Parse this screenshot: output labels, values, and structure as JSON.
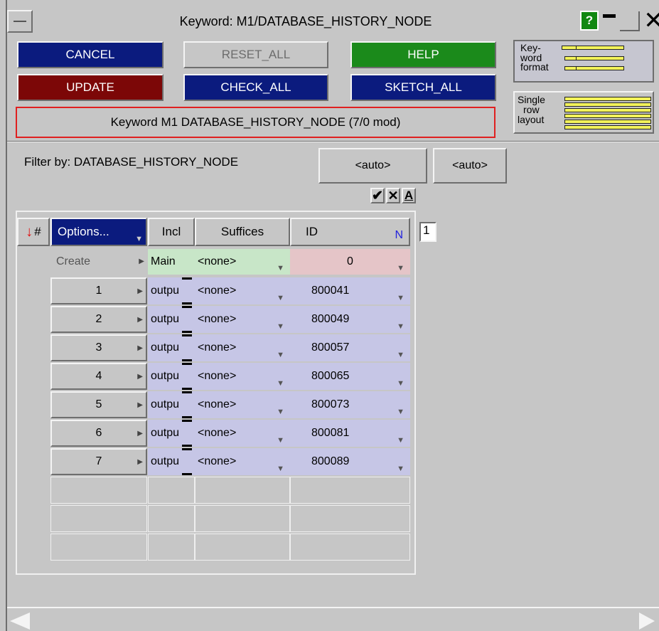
{
  "window": {
    "title": "Keyword: M1/DATABASE_HISTORY_NODE",
    "help_glyph": "?"
  },
  "buttons": {
    "cancel": "CANCEL",
    "reset_all": "RESET_ALL",
    "help": "HELP",
    "update": "UPDATE",
    "check_all": "CHECK_ALL",
    "sketch_all": "SKETCH_ALL"
  },
  "status": "Keyword M1 DATABASE_HISTORY_NODE (7/0 mod)",
  "format_panels": {
    "keyword_format": [
      "Key-",
      "word",
      "format"
    ],
    "single_row_layout": [
      "Single",
      "row",
      "layout"
    ]
  },
  "filter": {
    "label": "Filter by: DATABASE_HISTORY_NODE",
    "auto1": "<auto>",
    "auto2": "<auto>"
  },
  "toolbar_icons": [
    "checkmark-icon",
    "x-icon",
    "a-icon"
  ],
  "table": {
    "headers": {
      "hash": "#",
      "options": "Options...",
      "incl": "Incl",
      "suffices": "Suffices",
      "id": "ID",
      "n": "N"
    },
    "page_field": "1",
    "create_row": {
      "label": "Create",
      "incl": "Main",
      "suffices": "<none>",
      "id": "0"
    },
    "rows": [
      {
        "num": "1",
        "incl": "outpu",
        "suffices": "<none>",
        "id": "800041"
      },
      {
        "num": "2",
        "incl": "outpu",
        "suffices": "<none>",
        "id": "800049"
      },
      {
        "num": "3",
        "incl": "outpu",
        "suffices": "<none>",
        "id": "800057"
      },
      {
        "num": "4",
        "incl": "outpu",
        "suffices": "<none>",
        "id": "800065"
      },
      {
        "num": "5",
        "incl": "outpu",
        "suffices": "<none>",
        "id": "800073"
      },
      {
        "num": "6",
        "incl": "outpu",
        "suffices": "<none>",
        "id": "800081"
      },
      {
        "num": "7",
        "incl": "outpu",
        "suffices": "<none>",
        "id": "800089"
      }
    ],
    "empty_rows": 3
  },
  "colors": {
    "navy": "#0b1b7e",
    "green": "#1b8a1b",
    "maroon": "#7c0707",
    "status_border": "#e02020"
  }
}
